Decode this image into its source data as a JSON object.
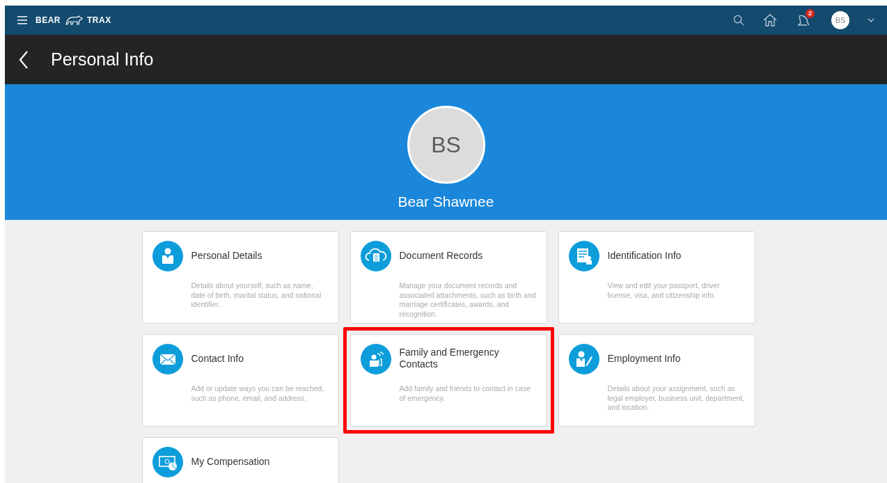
{
  "top_bar": {
    "logo_left": "BEAR",
    "logo_right": "TRAX",
    "notification_count": "2",
    "avatar": "BS"
  },
  "header": {
    "title": "Personal Info"
  },
  "profile": {
    "initials": "BS",
    "name": "Bear Shawnee"
  },
  "cards": [
    {
      "title": "Personal Details",
      "description": "Details about yourself, such as name, date of birth, marital status, and national identifier.",
      "highlighted": false
    },
    {
      "title": "Document Records",
      "description": "Manage your document records and associated attachments, such as birth and marriage certificates, awards, and recognition.",
      "highlighted": false
    },
    {
      "title": "Identification Info",
      "description": "View and edit your passport, driver license, visa, and citizenship info.",
      "highlighted": false
    },
    {
      "title": "Contact Info",
      "description": "Add or update ways you can be reached, such as phone, email, and address.",
      "highlighted": false
    },
    {
      "title": "Family and Emergency Contacts",
      "description": "Add family and friends to contact in case of emergency.",
      "highlighted": true
    },
    {
      "title": "Employment Info",
      "description": "Details about your assignment, such as legal employer, business unit, department, and location.",
      "highlighted": false
    },
    {
      "title": "My Compensation",
      "highlighted": false
    }
  ]
}
